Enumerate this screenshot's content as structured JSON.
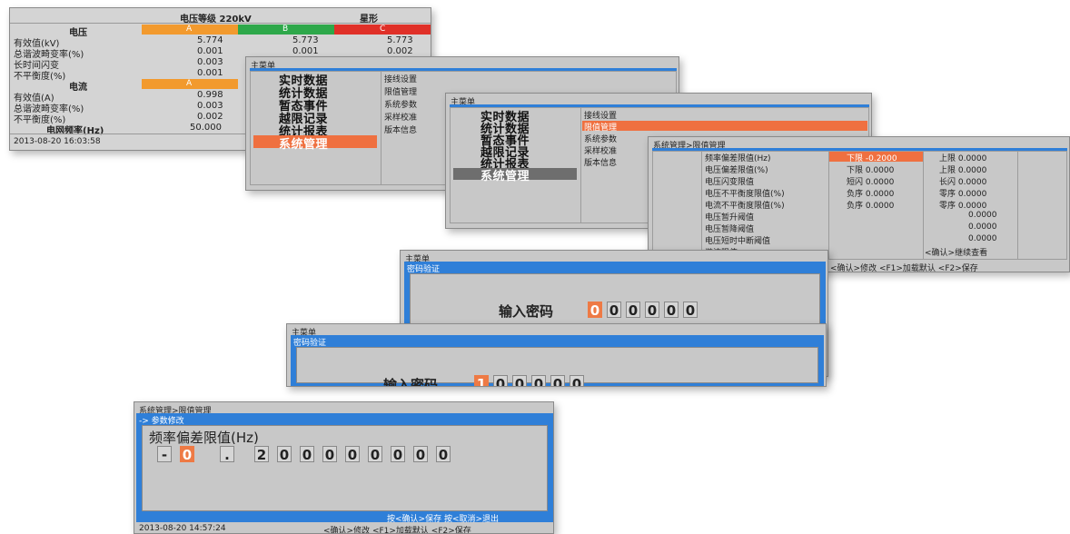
{
  "win1": {
    "header_level": "电压等级  220kV",
    "header_mode": "星形",
    "voltage_label": "电压",
    "phases": [
      "A",
      "B",
      "C"
    ],
    "rows_v": [
      {
        "label": "有效值(kV)",
        "vals": [
          "5.774",
          "5.773",
          "5.773"
        ]
      },
      {
        "label": "总谐波畸变率(%)",
        "vals": [
          "0.001",
          "0.001",
          "0.002"
        ]
      },
      {
        "label": "长时间闪变",
        "vals": [
          "0.003",
          "",
          ""
        ]
      },
      {
        "label": "不平衡度(%)",
        "vals": [
          "0.001",
          "",
          ""
        ]
      }
    ],
    "current_label": "电流",
    "phase_a": "A",
    "rows_i": [
      {
        "label": "有效值(A)",
        "val": "0.998"
      },
      {
        "label": "总谐波畸变率(%)",
        "val": "0.003"
      },
      {
        "label": "不平衡度(%)",
        "val": "0.002"
      }
    ],
    "freq_label": "电网频率(Hz)",
    "freq_val": "50.000",
    "timestamp": "2013-08-20 16:03:58"
  },
  "win2": {
    "title": "主菜单",
    "menu": [
      "实时数据",
      "统计数据",
      "暂态事件",
      "越限记录",
      "统计报表",
      "系统管理"
    ],
    "sub": [
      "接线设置",
      "限值管理",
      "系统参数",
      "采样校准",
      "版本信息"
    ]
  },
  "win3": {
    "title": "主菜单",
    "menu": [
      "实时数据",
      "统计数据",
      "暂态事件",
      "越限记录",
      "统计报表",
      "系统管理"
    ],
    "sub": [
      "接线设置",
      "限值管理",
      "系统参数",
      "采样校准",
      "版本信息"
    ]
  },
  "win4": {
    "title": "系统管理>限值管理",
    "rows": [
      {
        "label": "频率偏差限值(Hz)",
        "c1": "下限 -0.2000",
        "c2": "上限 0.0000"
      },
      {
        "label": "电压偏差限值(%)",
        "c1": "下限 0.0000",
        "c2": "上限 0.0000"
      },
      {
        "label": "电压闪变限值",
        "c1": "短闪 0.0000",
        "c2": "长闪 0.0000"
      },
      {
        "label": "电压不平衡度限值(%)",
        "c1": "负序 0.0000",
        "c2": "零序 0.0000"
      },
      {
        "label": "电流不平衡度限值(%)",
        "c1": "负序 0.0000",
        "c2": "零序 0.0000"
      },
      {
        "label": "电压暂升阈值",
        "c1": "",
        "c2": "0.0000"
      },
      {
        "label": "电压暂降阈值",
        "c1": "",
        "c2": "0.0000"
      },
      {
        "label": "电压短时中断阈值",
        "c1": "",
        "c2": "0.0000"
      },
      {
        "label": "谐波限值",
        "c1": "",
        "c2": "<确认>继续查看"
      }
    ],
    "footer": "<确认>修改  <F1>加载默认  <F2>保存"
  },
  "win5": {
    "title": "主菜单",
    "subtitle": "密码验证",
    "prompt": "输入密码",
    "digits": [
      "0",
      "0",
      "0",
      "0",
      "0",
      "0"
    ]
  },
  "win6": {
    "title": "主菜单",
    "subtitle": "密码验证",
    "prompt": "输入密码",
    "digits": [
      "1",
      "0",
      "0",
      "0",
      "0",
      "0"
    ]
  },
  "win7": {
    "title": "系统管理>限值管理",
    "subtitle": "-> 参数修改",
    "param": "频率偏差限值(Hz)",
    "digits": [
      "-",
      "0",
      ".",
      "2",
      "0",
      "0",
      "0",
      "0",
      "0",
      "0",
      "0",
      "0"
    ],
    "hint": "按<确认>保存  按<取消>退出",
    "timestamp": "2013-08-20 14:57:24",
    "footer": "<确认>修改  <F1>加载默认  <F2>保存"
  },
  "colors": {
    "phase_a": "#f29a2e",
    "phase_b": "#2ea84a",
    "phase_c": "#e03028",
    "highlight": "#ef7040",
    "accent": "#2f7fd8"
  }
}
